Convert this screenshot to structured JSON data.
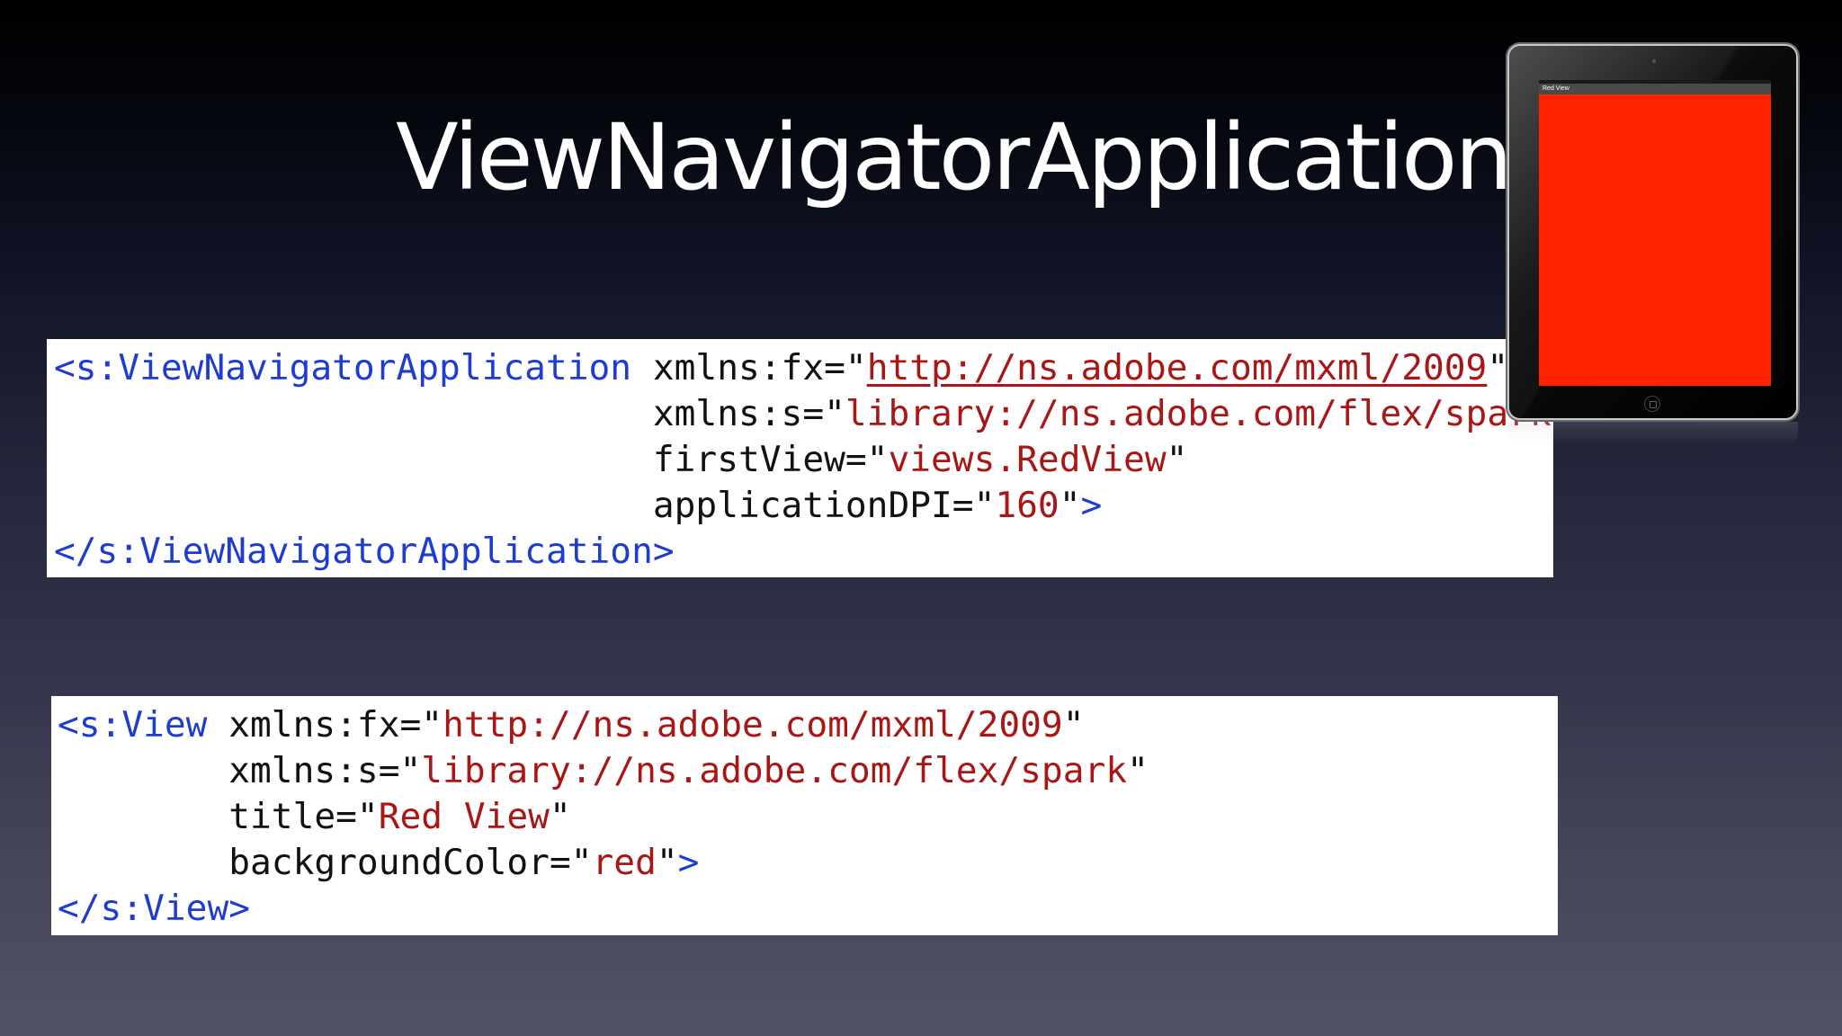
{
  "slide": {
    "title": "ViewNavigatorApplication"
  },
  "code_app": {
    "line1_tag": "<s:ViewNavigatorApplication",
    "line1_attr": " xmlns:fx=\"",
    "line1_val": "http://ns.adobe.com/mxml/2009",
    "line1_end": "\"",
    "line2_indent": "                            ",
    "line2_attr": "xmlns:s=\"",
    "line2_val": "library://ns.adobe.com/flex/spark",
    "line2_end": "\"",
    "line3_indent": "                            ",
    "line3_attr": "firstView=\"",
    "line3_val": "views.RedView",
    "line3_end": "\"",
    "line4_indent": "                            ",
    "line4_attr": "applicationDPI=\"",
    "line4_val": "160",
    "line4_q": "\"",
    "line4_close": ">",
    "line5_tag": "</s:ViewNavigatorApplication>"
  },
  "code_view": {
    "line1_tag": "<s:View",
    "line1_attr": " xmlns:fx=\"",
    "line1_val": "http://ns.adobe.com/mxml/2009",
    "line1_end": "\"",
    "line2_indent": "        ",
    "line2_attr": "xmlns:s=\"",
    "line2_val": "library://ns.adobe.com/flex/spark",
    "line2_end": "\"",
    "line3_indent": "        ",
    "line3_attr": "title=\"",
    "line3_val": "Red View",
    "line3_end": "\"",
    "line4_indent": "        ",
    "line4_attr": "backgroundColor=\"",
    "line4_val": "red",
    "line4_q": "\"",
    "line4_close": ">",
    "line5_tag": "</s:View>"
  },
  "device": {
    "action_bar_title": "Red View",
    "screen_color": "#ff2200"
  },
  "colors": {
    "tag": "#1f3cd0",
    "string": "#a81616",
    "title_text": "#ffffff"
  }
}
